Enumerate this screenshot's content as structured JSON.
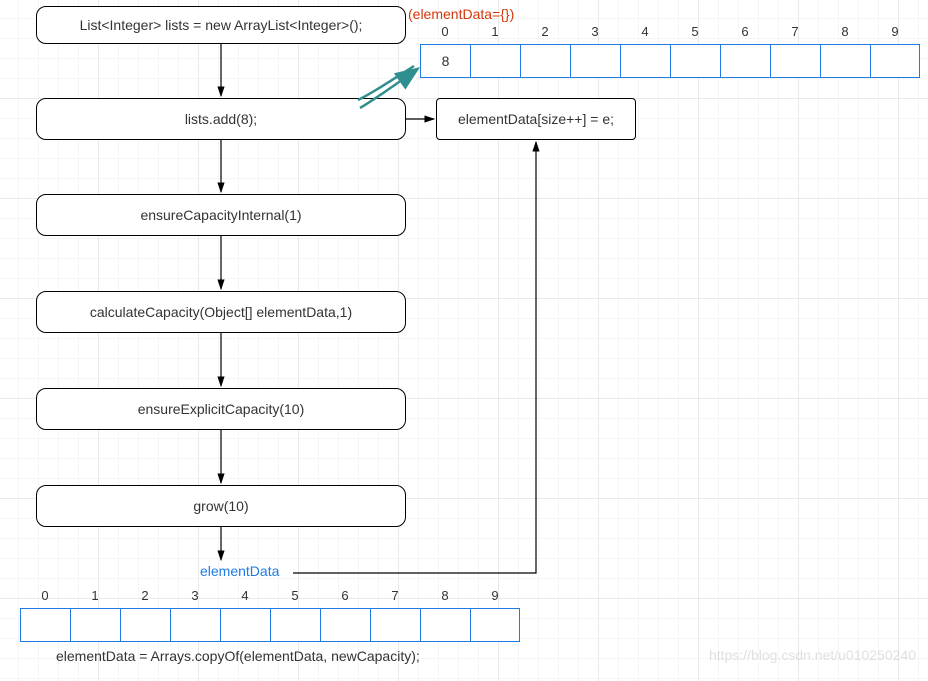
{
  "nodes": {
    "n1": "List<Integer> lists = new ArrayList<Integer>();",
    "n2": "lists.add(8);",
    "n3": "ensureCapacityInternal(1)",
    "n4": "calculateCapacity(Object[] elementData,1)",
    "n5": "ensureExplicitCapacity(10)",
    "n6": "grow(10)",
    "n7": "elementData[size++] = e;"
  },
  "annotations": {
    "after_ctor": "(elementData={})",
    "element_data_label": "elementData",
    "copy_of": "elementData = Arrays.copyOf(elementData, newCapacity);"
  },
  "top_array": {
    "indices": [
      "0",
      "1",
      "2",
      "3",
      "4",
      "5",
      "6",
      "7",
      "8",
      "9"
    ],
    "cells": [
      "8",
      "",
      "",
      "",
      "",
      "",
      "",
      "",
      "",
      ""
    ]
  },
  "bottom_array": {
    "indices": [
      "0",
      "1",
      "2",
      "3",
      "4",
      "5",
      "6",
      "7",
      "8",
      "9"
    ],
    "cells": [
      "",
      "",
      "",
      "",
      "",
      "",
      "",
      "",
      "",
      ""
    ]
  },
  "watermark": "https://blog.csdn.net/u010250240"
}
